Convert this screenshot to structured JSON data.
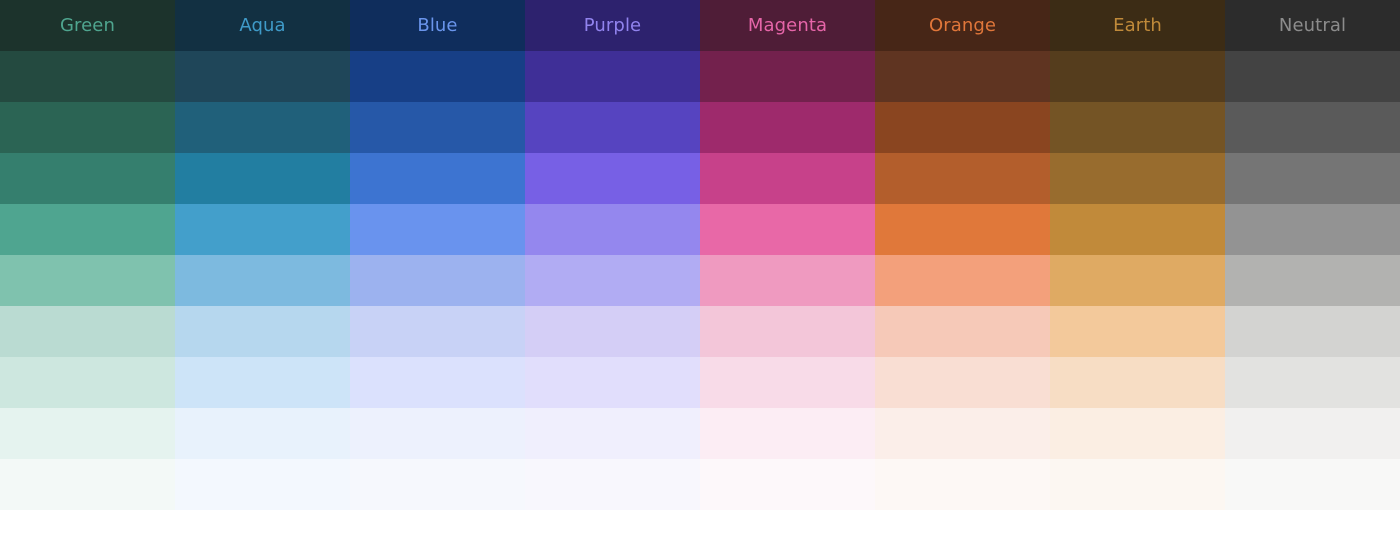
{
  "palette": {
    "columns": [
      {
        "name": "Green",
        "label_color": "#4fa58f",
        "swatches": [
          "#1c332c",
          "#244a40",
          "#2b6454",
          "#357f6e",
          "#4fa590",
          "#7fc2ae",
          "#badbd2",
          "#cde7df",
          "#e5f3ef",
          "#f3f9f7"
        ]
      },
      {
        "name": "Aqua",
        "label_color": "#3f9ac8",
        "swatches": [
          "#123042",
          "#1f4659",
          "#20607a",
          "#227ea1",
          "#439fcb",
          "#7dbadf",
          "#b6d7ee",
          "#cde4f8",
          "#e8f2fc",
          "#f3f8fe"
        ]
      },
      {
        "name": "Blue",
        "label_color": "#6a95ec",
        "swatches": [
          "#0f2d5c",
          "#173f86",
          "#2658a8",
          "#3d74d1",
          "#6993ee",
          "#9cb2ef",
          "#c8d2f6",
          "#dbe1fd",
          "#edf1fd",
          "#f6f8fd"
        ]
      },
      {
        "name": "Purple",
        "label_color": "#9183ee",
        "swatches": [
          "#2d226e",
          "#3f2f97",
          "#5644c0",
          "#7760e5",
          "#9487ee",
          "#b1acf3",
          "#d4cef6",
          "#e1defc",
          "#f0effd",
          "#f8f7fd"
        ]
      },
      {
        "name": "Magenta",
        "label_color": "#e665a8",
        "swatches": [
          "#4f1d37",
          "#73214d",
          "#9e2a6c",
          "#c7418a",
          "#e868a7",
          "#ef9ac0",
          "#f3c6d9",
          "#f8dbe8",
          "#fcedf4",
          "#fdf8fa"
        ]
      },
      {
        "name": "Orange",
        "label_color": "#e0763a",
        "swatches": [
          "#472617",
          "#5f3421",
          "#8a4520",
          "#b35e2c",
          "#e0783a",
          "#f3a07b",
          "#f6c9b8",
          "#f9ded3",
          "#fbeee9",
          "#fdf8f5"
        ]
      },
      {
        "name": "Earth",
        "label_color": "#c08a3a",
        "swatches": [
          "#3c2c15",
          "#553d1d",
          "#745425",
          "#986c2e",
          "#c18a3a",
          "#dfaa63",
          "#f3c99b",
          "#f7ddc4",
          "#fbeee3",
          "#fcf7f2"
        ]
      },
      {
        "name": "Neutral",
        "label_color": "#8c8c8c",
        "swatches": [
          "#2c2c2c",
          "#434343",
          "#5a5a5a",
          "#757575",
          "#939393",
          "#b2b2b0",
          "#d3d3d1",
          "#e2e2e0",
          "#f1f0ef",
          "#f8f8f7"
        ]
      }
    ]
  }
}
